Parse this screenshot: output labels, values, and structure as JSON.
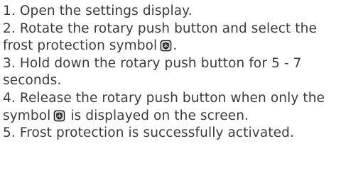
{
  "instructions": {
    "step1": "1. Open the settings display.",
    "step2_before": "2. Rotate the rotary push button and select the frost protection symbol",
    "step2_after": ".",
    "step3": "3. Hold down the rotary push button for 5 - 7 seconds.",
    "step4_before": "4. Release the rotary push button when only the symbol",
    "step4_after": "is displayed on the screen.",
    "step5": "5. Frost protection is successfully activated."
  },
  "icons": {
    "frost_protection": "frost-protection-icon"
  },
  "colors": {
    "text": "#3a3a3a",
    "icon_dark": "#1e1e1e",
    "icon_light": "#d9d9d9"
  }
}
